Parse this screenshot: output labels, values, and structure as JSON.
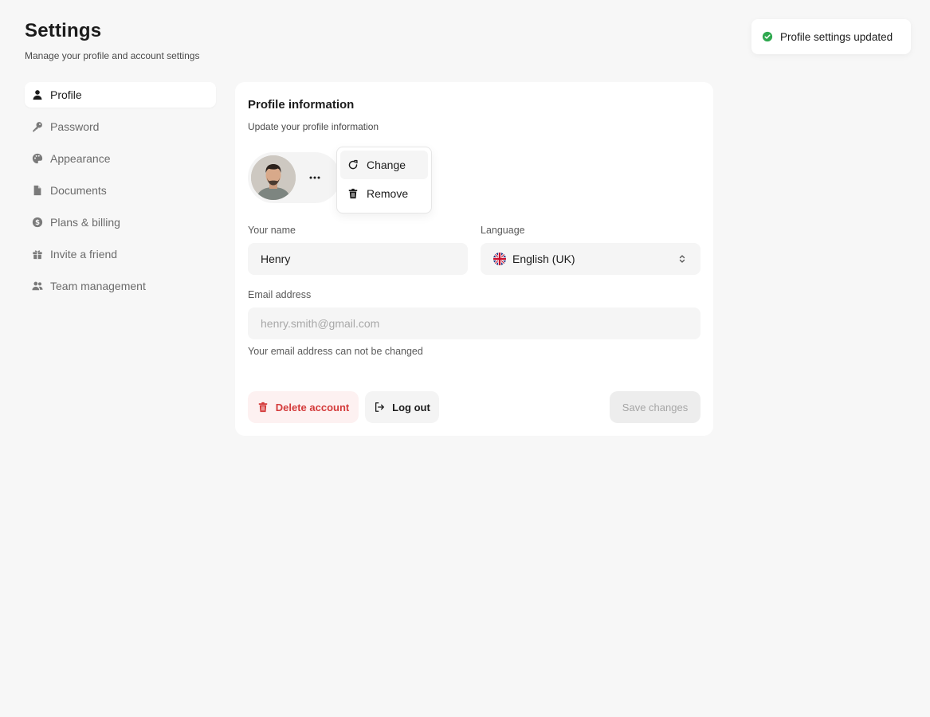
{
  "header": {
    "title": "Settings",
    "subtitle": "Manage your profile and account settings"
  },
  "sidebar": {
    "items": [
      {
        "label": "Profile",
        "icon": "user-icon",
        "active": true
      },
      {
        "label": "Password",
        "icon": "key-icon"
      },
      {
        "label": "Appearance",
        "icon": "palette-icon"
      },
      {
        "label": "Documents",
        "icon": "file-icon"
      },
      {
        "label": "Plans & billing",
        "icon": "dollar-circle-icon"
      },
      {
        "label": "Invite a friend",
        "icon": "gift-icon"
      },
      {
        "label": "Team management",
        "icon": "users-icon"
      }
    ]
  },
  "profile_card": {
    "title": "Profile information",
    "subtitle": "Update your profile information",
    "avatar": {
      "icon": "avatar-photo",
      "menu_icon": "more-horizontal-icon"
    },
    "avatar_menu": {
      "items": [
        {
          "label": "Change",
          "icon": "refresh-icon"
        },
        {
          "label": "Remove",
          "icon": "trash-icon"
        }
      ]
    },
    "name": {
      "label": "Your name",
      "value": "Henry"
    },
    "language": {
      "label": "Language",
      "value": "English (UK)",
      "flag_icon": "uk-flag-icon",
      "chevron_icon": "chevron-up-down-icon"
    },
    "email": {
      "label": "Email address",
      "value": "henry.smith@gmail.com",
      "helper": "Your email address can not be changed"
    },
    "actions": {
      "delete_label": "Delete account",
      "logout_label": "Log out",
      "save_label": "Save changes"
    }
  },
  "toast": {
    "message": "Profile settings updated",
    "icon": "check-circle-icon"
  },
  "colors": {
    "background": "#f7f7f7",
    "danger": "#d43b3b",
    "danger_bg": "#fdf1f1",
    "success": "#2fa84f"
  }
}
